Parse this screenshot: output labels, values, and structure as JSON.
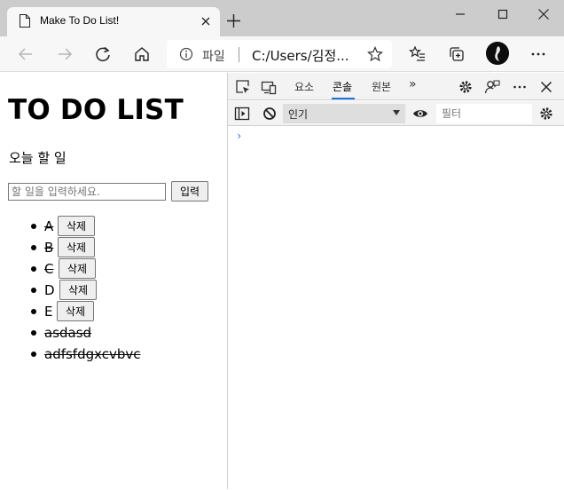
{
  "browser": {
    "tab_title": "Make To Do List!",
    "address_scheme": "파일",
    "address_url": "C:/Users/김정..."
  },
  "page": {
    "title": "TO DO LIST",
    "subtitle": "오늘 할 일",
    "input_placeholder": "할 일을 입력하세요.",
    "enter_label": "입력",
    "delete_label": "삭제",
    "items": [
      {
        "text": "A",
        "done": true,
        "has_delete": true
      },
      {
        "text": "B",
        "done": true,
        "has_delete": true
      },
      {
        "text": "C",
        "done": true,
        "has_delete": true
      },
      {
        "text": "D",
        "done": false,
        "has_delete": true
      },
      {
        "text": "E",
        "done": false,
        "has_delete": true
      },
      {
        "text": "asdasd",
        "done": true,
        "has_delete": false
      },
      {
        "text": "adfsfdgxcvbvc",
        "done": true,
        "has_delete": false
      }
    ]
  },
  "devtools": {
    "tabs": [
      {
        "label": "요소",
        "active": false
      },
      {
        "label": "콘솔",
        "active": true
      },
      {
        "label": "원본",
        "active": false
      }
    ],
    "more_tabs": "»",
    "context_select": "인기",
    "filter_placeholder": "필터",
    "prompt_symbol": "›"
  },
  "colors": {
    "titlebar": "#cccccc",
    "toolbar": "#f7f7f7",
    "devtools_bg": "#f3f3f3",
    "accent": "#1a73e8"
  }
}
